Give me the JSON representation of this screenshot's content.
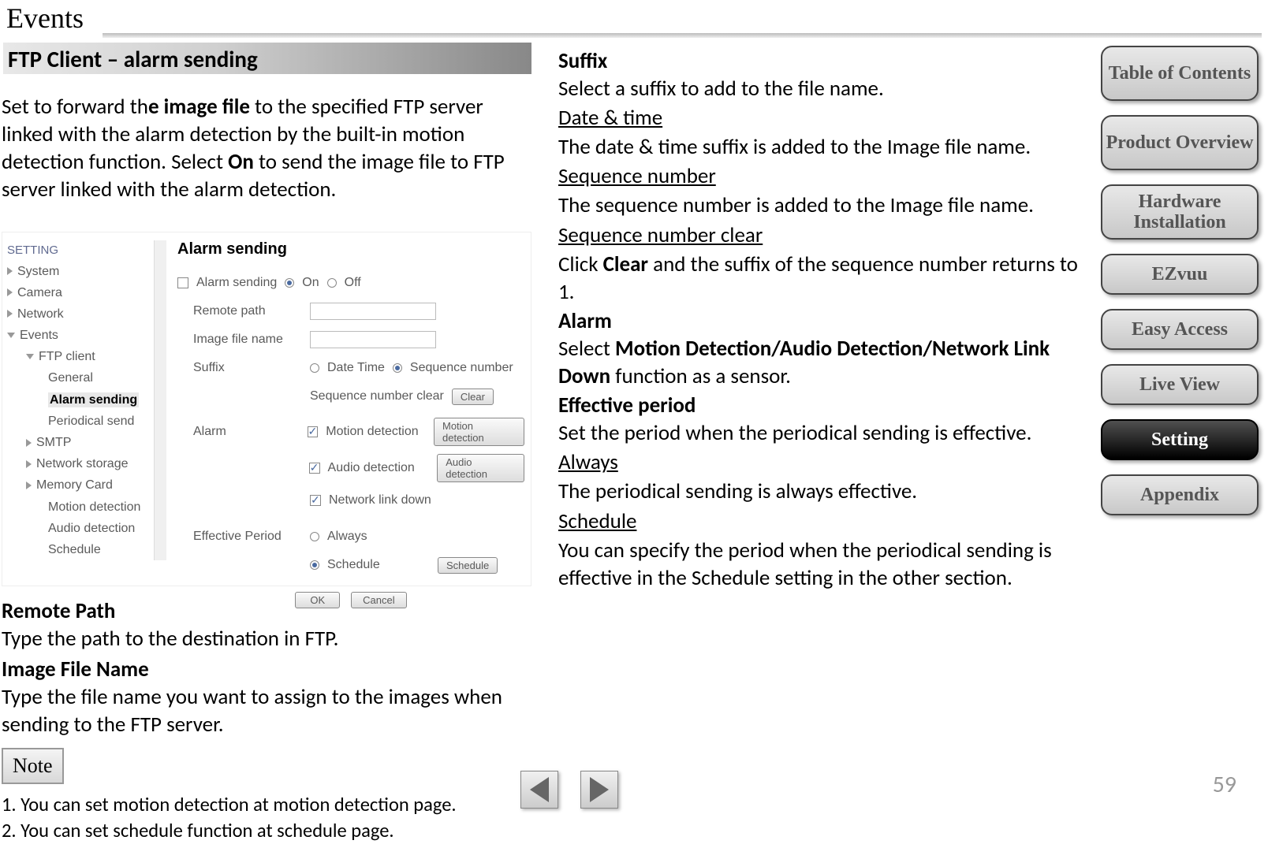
{
  "page": {
    "title": "Events",
    "section_header": "FTP Client – alarm sending",
    "intro_html": "Set to forward th<b>e image file</b> to the specified FTP server linked with the alarm detection by the built-in motion detection function. Select <b>On</b> to send the image file to FTP server linked with the alarm detection.",
    "page_number": "59"
  },
  "screenshot": {
    "tree_header": "SETTING",
    "tree": [
      "System",
      "Camera",
      "Network",
      "Events"
    ],
    "tree_ftp": "FTP client",
    "tree_ftp_children": [
      "General",
      "Alarm sending",
      "Periodical send"
    ],
    "tree_more": [
      "SMTP",
      "Network storage",
      "Memory Card"
    ],
    "tree_more_sub": [
      "Motion detection",
      "Audio detection",
      "Schedule"
    ],
    "form_title": "Alarm sending",
    "rows": {
      "alarm_sending": "Alarm sending",
      "on": "On",
      "off": "Off",
      "remote_path": "Remote path",
      "image_file_name": "Image file name",
      "suffix": "Suffix",
      "date_time": "Date Time",
      "sequence_number": "Sequence number",
      "seq_clear": "Sequence number clear",
      "clear_btn": "Clear",
      "alarm": "Alarm",
      "motion_detection": "Motion detection",
      "audio_detection": "Audio detection",
      "network_link_down": "Network link down",
      "effective_period": "Effective Period",
      "always": "Always",
      "schedule": "Schedule",
      "schedule_btn": "Schedule",
      "ok": "OK",
      "cancel": "Cancel"
    }
  },
  "col1_below": {
    "remote_path_h": "Remote Path",
    "remote_path_p": "Type the path to the destination in FTP.",
    "image_file_h": "Image File Name",
    "image_file_p": "Type the file name you want to assign to the images when sending to the FTP server.",
    "note_label": "Note",
    "note1": "1. You can set motion detection at motion detection page.",
    "note2": "2. You can set schedule function at schedule page."
  },
  "col2": {
    "suffix_h": "Suffix",
    "suffix_p": "Select a suffix to add to the file name.",
    "dt_h": "Date & time",
    "dt_p": "The date & time suffix is added to the Image file name.",
    "sn_h": "Sequence number",
    "sn_p": "The sequence number is added to the Image file name.",
    "snc_h": "Sequence number clear",
    "snc_p_html": "Click <b>Clear</b> and the suffix of the sequence number returns to 1.",
    "alarm_h": "Alarm",
    "alarm_p_html": "Select <b>Motion Detection/Audio Detection/Network Link Down</b>  function as a sensor.",
    "ep_h": "Effective period",
    "ep_p": "Set the period when the periodical sending is effective.",
    "always_h": "Always",
    "always_p": "The periodical sending is always effective.",
    "sched_h": "Schedule",
    "sched_p": "You can specify the period when the periodical sending is effective in the Schedule setting in the other section."
  },
  "nav": {
    "toc": "Table of Contents",
    "product": "Product Overview",
    "hardware": "Hardware Installation",
    "ezvuu": "EZvuu",
    "easy": "Easy Access",
    "live": "Live View",
    "setting": "Setting",
    "appendix": "Appendix"
  }
}
